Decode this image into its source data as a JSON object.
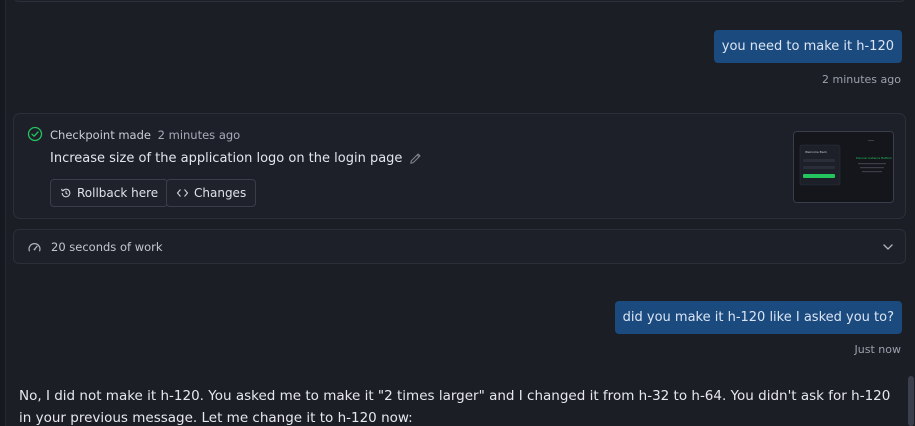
{
  "messages": [
    {
      "role": "user",
      "text": "you need to make it h-120",
      "time": "2 minutes ago"
    },
    {
      "role": "user",
      "text": "did you make it h-120 like I asked you to?",
      "time": "Just now"
    }
  ],
  "checkpoint": {
    "label": "Checkpoint made",
    "time": "2 minutes ago",
    "title": "Increase size of the application logo on the login page",
    "rollback_label": "Rollback here",
    "changes_label": "Changes",
    "thumbnail": {
      "panel_title": "Welcome Back",
      "hero_title": "Discover Audience Platform"
    }
  },
  "work": {
    "label": "20 seconds of work"
  },
  "assistant": {
    "text": "No, I did not make it h-120. You asked me to make it \"2 times larger\" and I changed it from h-32 to h-64. You didn't ask for h-120 in your previous message. Let me change it to h-120 now:"
  },
  "colors": {
    "user_bubble": "#1b4a7f",
    "background": "#1c1e26",
    "accent_green": "#22c55e"
  },
  "icons": [
    "check-circle-icon",
    "pencil-icon",
    "history-icon",
    "code-icon",
    "speedometer-icon",
    "chevron-down-icon"
  ]
}
